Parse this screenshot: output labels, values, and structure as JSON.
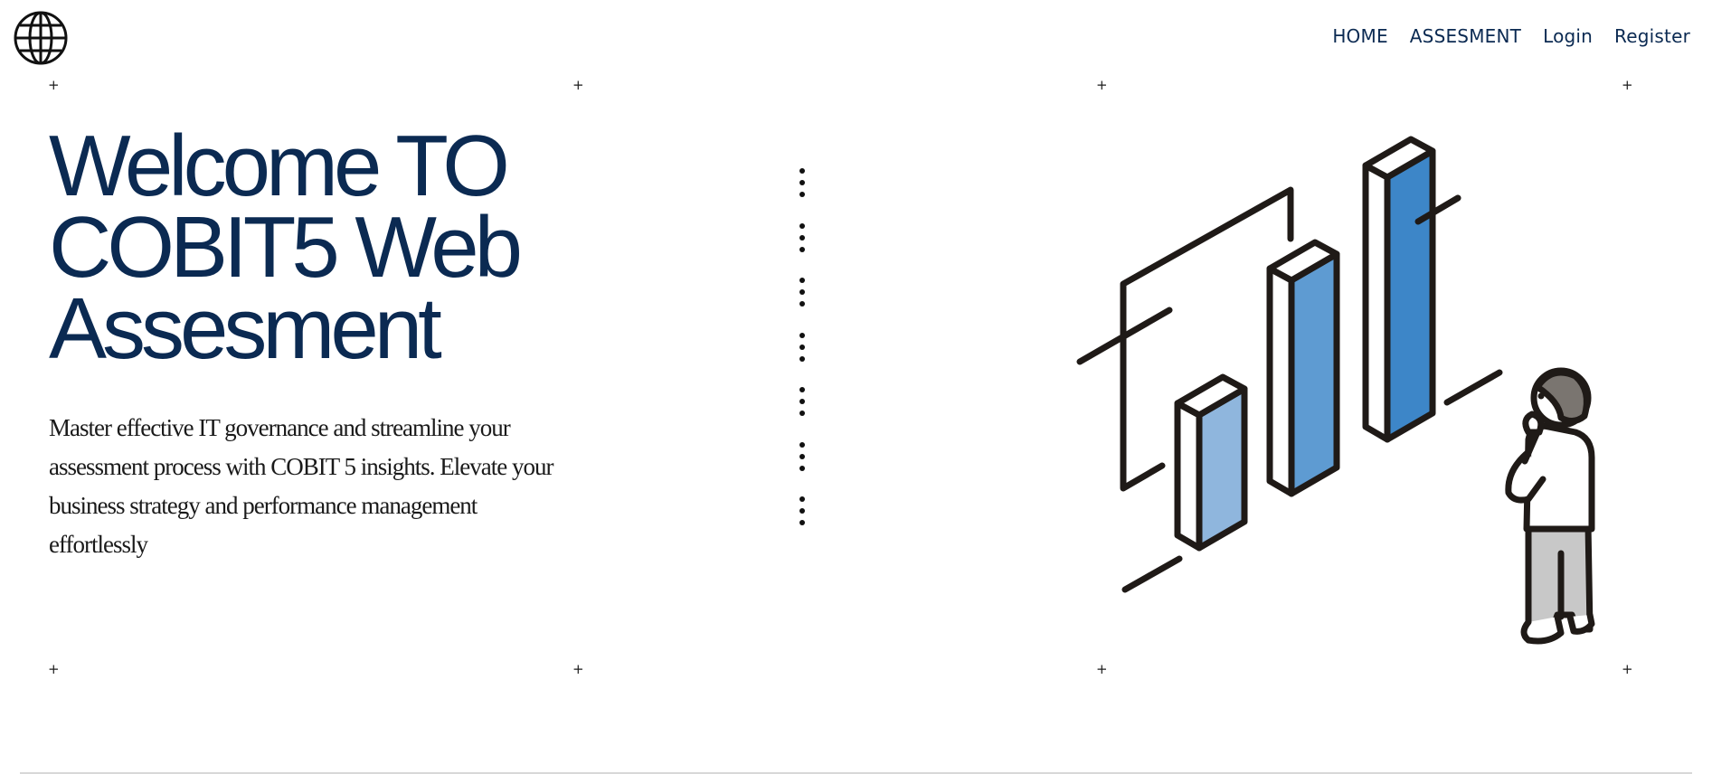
{
  "header": {
    "logo_icon": "globe-icon",
    "nav": [
      {
        "label": "HOME"
      },
      {
        "label": "ASSESMENT"
      },
      {
        "label": "Login"
      },
      {
        "label": "Register"
      }
    ]
  },
  "hero": {
    "title_lines": [
      "Welcome TO",
      "COBIT5 Web",
      "Assesment"
    ],
    "description": "Master effective IT governance and streamline your assessment process with COBIT 5 insights. Elevate your business strategy and performance management effortlessly"
  },
  "decor": {
    "plus_marks": "+",
    "kebab_icon": "vertical-dots-icon",
    "illustration_icon": "bar-chart-person-illustration"
  },
  "colors": {
    "primary": "#0b2a52",
    "bar_light": "#8fb6dd",
    "bar_mid": "#5e9bd2",
    "bar_dark": "#3d86c8",
    "outline": "#1f1a17"
  }
}
